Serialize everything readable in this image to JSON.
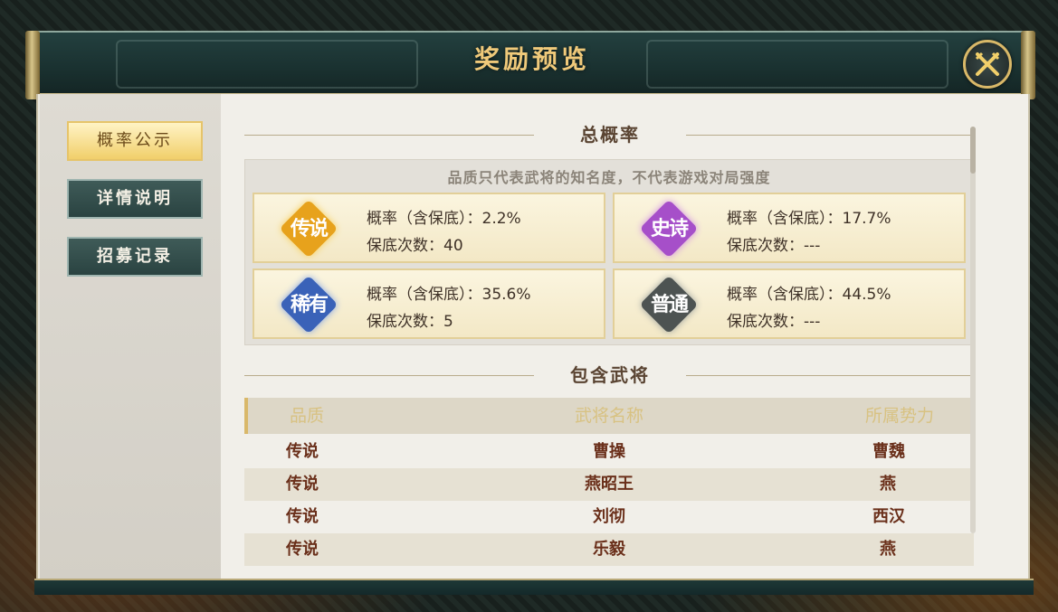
{
  "dialog": {
    "title": "奖励预览",
    "close_icon": "close-swords-icon"
  },
  "sidebar": {
    "items": [
      {
        "label": "概率公示",
        "active": true
      },
      {
        "label": "详情说明",
        "active": false
      },
      {
        "label": "招募记录",
        "active": false
      }
    ]
  },
  "probability": {
    "section_title": "总概率",
    "notice": "品质只代表武将的知名度，不代表游戏对局强度",
    "cards": [
      {
        "badge": "传说",
        "badge_color": "#e7a21c",
        "rate": "概率（含保底）：2.2%",
        "pity": "保底次数：40"
      },
      {
        "badge": "史诗",
        "badge_color": "#a64fc9",
        "rate": "概率（含保底）：17.7%",
        "pity": "保底次数：---"
      },
      {
        "badge": "稀有",
        "badge_color": "#3a62b8",
        "rate": "概率（含保底）：35.6%",
        "pity": "保底次数：5"
      },
      {
        "badge": "普通",
        "badge_color": "#4d5352",
        "rate": "概率（含保底）：44.5%",
        "pity": "保底次数：---"
      }
    ]
  },
  "generals": {
    "section_title": "包含武将",
    "headers": [
      "品质",
      "武将名称",
      "所属势力"
    ],
    "rows": [
      [
        "传说",
        "曹操",
        "曹魏"
      ],
      [
        "传说",
        "燕昭王",
        "燕"
      ],
      [
        "传说",
        "刘彻",
        "西汉"
      ],
      [
        "传说",
        "乐毅",
        "燕"
      ]
    ]
  },
  "colors": {
    "title_gold": "#efc97a",
    "header_teal": "#1a3130",
    "row_text": "#6a2f1a"
  }
}
